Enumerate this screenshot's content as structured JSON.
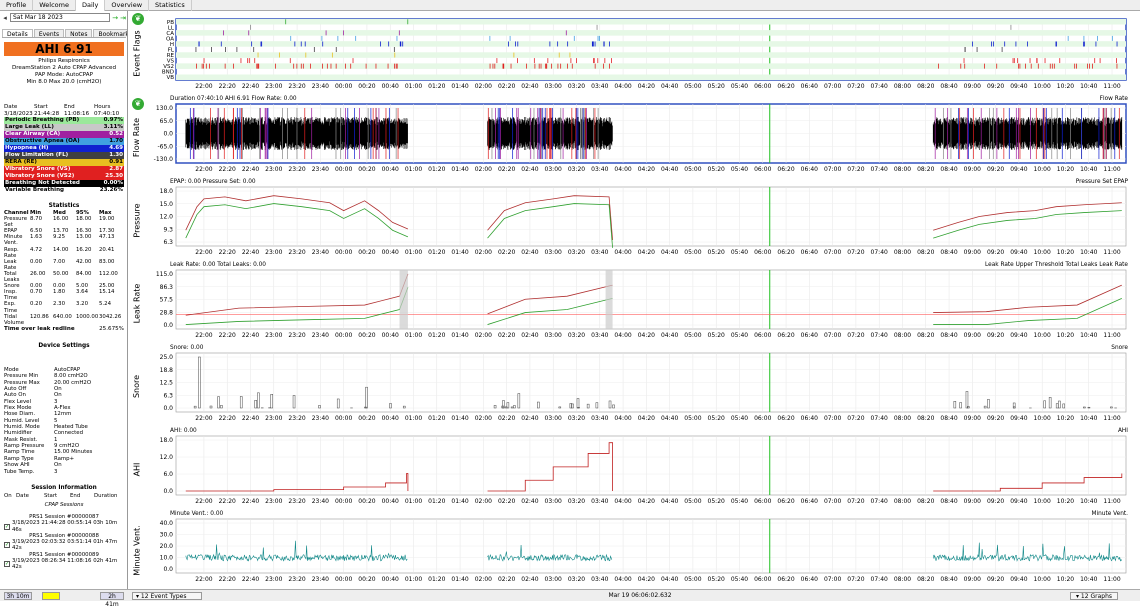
{
  "tabs": [
    "Profile",
    "Welcome",
    "Daily",
    "Overview",
    "Statistics"
  ],
  "date": "Sat Mar 18 2023",
  "subtabs": [
    "Details",
    "Events",
    "Notes",
    "Bookmarks"
  ],
  "ahi": "AHI 6.91",
  "machine": {
    "brand": "Philips Respironics",
    "model": "DreamStation 2 Auto CPAP Advanced",
    "mode": "PAP Mode: AutoCPAP",
    "range": "Min 8.0 Max 20.0 (cmH2O)"
  },
  "summary": {
    "headers": [
      "Date",
      "Start",
      "End",
      "Hours"
    ],
    "values": [
      "3/18/2023",
      "21:44:28",
      "11:08:16",
      "07:40:10"
    ]
  },
  "events": [
    {
      "name": "Periodic Breathing (PB)",
      "value": "0.97%",
      "color": "#9be89b",
      "fg": "#000"
    },
    {
      "name": "Large Leak (LL)",
      "value": "3.11%",
      "color": "#c8c8c8",
      "fg": "#000"
    },
    {
      "name": "Clear Airway (CA)",
      "value": "0.52",
      "color": "#a020a0",
      "fg": "#fff"
    },
    {
      "name": "Obstructive Apnea (OA)",
      "value": "1.70",
      "color": "#40a0e0",
      "fg": "#000"
    },
    {
      "name": "Hypopnea (H)",
      "value": "4.69",
      "color": "#1020d0",
      "fg": "#fff"
    },
    {
      "name": "Flow Limitation (FL)",
      "value": "1.30",
      "color": "#404040",
      "fg": "#fff"
    },
    {
      "name": "RERA (RE)",
      "value": "0.91",
      "color": "#e8c020",
      "fg": "#000"
    },
    {
      "name": "Vibratory Snore (VS)",
      "value": "2.87",
      "color": "#e02020",
      "fg": "#fff"
    },
    {
      "name": "Vibratory Snore (VS2)",
      "value": "25.30",
      "color": "#e02020",
      "fg": "#fff"
    },
    {
      "name": "Breathing Not Detected",
      "value": "0.00%",
      "color": "#000000",
      "fg": "#fff"
    },
    {
      "name": "Variable Breathing",
      "value": "23.26%",
      "color": "#ffffff",
      "fg": "#000"
    }
  ],
  "stats_title": "Statistics",
  "stats_headers": [
    "Channel",
    "Min",
    "Med",
    "95%",
    "Max"
  ],
  "stats": [
    [
      "Pressure",
      "8.70",
      "16.00",
      "18.00",
      "19.00"
    ],
    [
      "Set",
      "",
      "",
      "",
      ""
    ],
    [
      "EPAP",
      "6.50",
      "13.70",
      "16.30",
      "17.30"
    ],
    [
      "Minute",
      "1.63",
      "9.25",
      "13.00",
      "47.13"
    ],
    [
      "Vent.",
      "",
      "",
      "",
      ""
    ],
    [
      "Resp.",
      "4.72",
      "14.00",
      "16.20",
      "20.41"
    ],
    [
      "Rate",
      "",
      "",
      "",
      ""
    ],
    [
      "Leak Rate",
      "0.00",
      "7.00",
      "42.00",
      "83.00"
    ],
    [
      "Total",
      "26.00",
      "50.00",
      "84.00",
      "112.00"
    ],
    [
      "Leaks",
      "",
      "",
      "",
      ""
    ],
    [
      "Snore",
      "0.00",
      "0.00",
      "5.00",
      "25.00"
    ],
    [
      "Insp.",
      "0.70",
      "1.80",
      "3.64",
      "15.14"
    ],
    [
      "Time",
      "",
      "",
      "",
      ""
    ],
    [
      "Exp. Time",
      "0.20",
      "2.30",
      "3.20",
      "5.24"
    ],
    [
      "Tidal",
      "120.86",
      "640.00",
      "1000.00",
      "3042.26"
    ],
    [
      "Volume",
      "",
      "",
      "",
      ""
    ]
  ],
  "leak_redline": {
    "label": "Time over leak redline",
    "value": "25.675%"
  },
  "device_title": "Device Settings",
  "device": [
    [
      "Mode",
      "AutoCPAP"
    ],
    [
      "Pressure Min",
      "8.00 cmH2O"
    ],
    [
      "Pressure Max",
      "20.00 cmH2O"
    ],
    [
      "Auto Off",
      "On"
    ],
    [
      "Auto On",
      "On"
    ],
    [
      "Flex Level",
      "3"
    ],
    [
      "Flex Mode",
      "A-Flex"
    ],
    [
      "Hose Diam.",
      "12mm"
    ],
    [
      "Humid. Level",
      "5"
    ],
    [
      "Humid. Mode",
      "Heated Tube"
    ],
    [
      "Humidifier",
      "Connected"
    ],
    [
      "Mask Resist.",
      "1"
    ],
    [
      "Ramp Pressure",
      "9 cmH2O"
    ],
    [
      "Ramp Time",
      "15.00 Minutes"
    ],
    [
      "Ramp Type",
      "Ramp+"
    ],
    [
      "Show AHI",
      "On"
    ],
    [
      "Tube Temp.",
      "3"
    ]
  ],
  "session_title": "Session Information",
  "sessions_headers": [
    "On",
    "Date",
    "Start",
    "End",
    "Duration"
  ],
  "sessions_group": "CPAP Sessions",
  "sessions": [
    {
      "name": "PRS1 Session #00000087",
      "row": "3/18/2023 21:44:28 00:55:14 03h 10m 46s"
    },
    {
      "name": "PRS1 Session #00000088",
      "row": "3/19/2023 02:03:32 03:51:14 01h 47m 42s"
    },
    {
      "name": "PRS1 Session #00000089",
      "row": "3/19/2023 08:26:34 11:08:16 02h 41m 42s"
    }
  ],
  "bottom": {
    "left": "3h 10m",
    "right": "2h 41m",
    "event_types": "12 Event Types",
    "time": "Mar 19 06:06:02.632",
    "graphs": "12 Graphs"
  },
  "time_ticks": [
    "22:00",
    "22:20",
    "22:40",
    "23:00",
    "23:20",
    "23:40",
    "00:00",
    "00:20",
    "00:40",
    "01:00",
    "01:20",
    "01:40",
    "02:00",
    "02:20",
    "02:40",
    "03:00",
    "03:20",
    "03:40",
    "04:00",
    "04:20",
    "04:40",
    "05:00",
    "05:20",
    "05:40",
    "06:00",
    "06:20",
    "06:40",
    "07:00",
    "07:20",
    "07:40",
    "08:00",
    "08:20",
    "08:40",
    "09:00",
    "09:20",
    "09:40",
    "10:00",
    "10:20",
    "10:40",
    "11:00"
  ],
  "panes": {
    "events": {
      "title": "Event Flags",
      "rows": [
        "PB",
        "LL",
        "CA",
        "OA",
        "H",
        "FL",
        "RE",
        "VS",
        "VS2",
        "BND",
        "VB"
      ]
    },
    "flow": {
      "title": "Flow Rate",
      "header": "Duration 07:40:10 AHI 6.91 Flow Rate: 0.00",
      "legend": "Flow Rate",
      "yticks": [
        "130.0",
        "65.0",
        "0.0",
        "-65.0",
        "-130.0"
      ]
    },
    "pressure": {
      "title": "Pressure",
      "header": "EPAP: 0.00 Pressure Set: 0.00",
      "legend": "Pressure Set  EPAP",
      "yticks": [
        "18.0",
        "15.0",
        "12.0",
        "9.3",
        "6.3"
      ]
    },
    "leak": {
      "title": "Leak Rate",
      "header": "Leak Rate: 0.00 Total Leaks: 0.00",
      "legend": "Leak Rate Upper Threshold  Total Leaks  Leak Rate",
      "yticks": [
        "115.0",
        "86.3",
        "57.5",
        "28.8",
        "0.0"
      ]
    },
    "snore": {
      "title": "Snore",
      "header": "Snore: 0.00",
      "legend": "Snore",
      "yticks": [
        "25.0",
        "18.8",
        "12.5",
        "6.3",
        "0.0"
      ]
    },
    "ahi": {
      "title": "AHI",
      "header": "AHI: 0.00",
      "legend": "AHI",
      "yticks": [
        "18.0",
        "12.0",
        "6.0",
        "0.0"
      ]
    },
    "mv": {
      "title": "Minute Vent.",
      "header": "Minute Vent.: 0.00",
      "legend": "Minute Vent.",
      "yticks": [
        "40.0",
        "30.0",
        "20.0",
        "10.0",
        "0.0"
      ]
    }
  },
  "colors": {
    "pressure": "#b03030",
    "epap": "#30a030",
    "leak": "#30a030",
    "total": "#b03030",
    "threshold": "#ff6060",
    "mv": "#108888",
    "ahi": "#c02020",
    "cursor": "#20c020"
  }
}
